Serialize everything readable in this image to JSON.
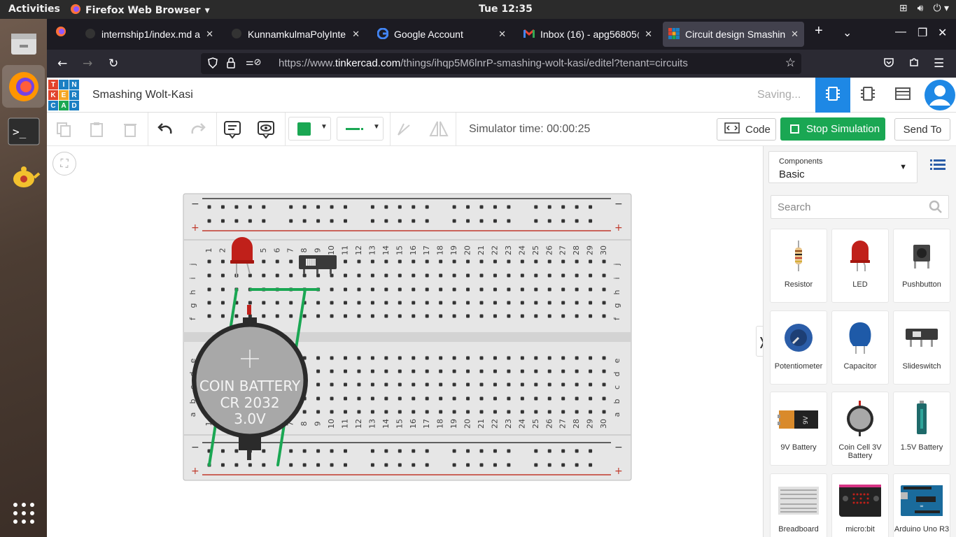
{
  "system_bar": {
    "activities": "Activities",
    "app_name": "Firefox Web Browser",
    "clock": "Tue 12:35"
  },
  "tabs": [
    {
      "title": "internship1/index.md a"
    },
    {
      "title": "KunnamkulmaPolyInte"
    },
    {
      "title": "Google Account"
    },
    {
      "title": "Inbox (16) - apg56805@"
    },
    {
      "title": "Circuit design Smashin"
    }
  ],
  "url": {
    "prefix": "https://www.",
    "domain": "tinkercad.com",
    "path": "/things/ihqp5M6lnrP-smashing-wolt-kasi/editel?tenant=circuits"
  },
  "tinkercad": {
    "logo_letters": [
      "T",
      "I",
      "N",
      "K",
      "E",
      "R",
      "C",
      "A",
      "D"
    ],
    "logo_colors": [
      "#e2432c",
      "#1b7fc3",
      "#1b7fc3",
      "#e2432c",
      "#f5a623",
      "#1b7fc3",
      "#1b7fc3",
      "#1aa753",
      "#1b7fc3"
    ],
    "project_title": "Smashing Wolt-Kasi",
    "saving": "Saving..."
  },
  "toolbar": {
    "sim_time": "Simulator time: 00:00:25",
    "code": "Code",
    "stop": "Stop Simulation",
    "send_to": "Send To",
    "wire_color": "#1aa753"
  },
  "battery": {
    "line1": "COIN BATTERY",
    "line2": "CR 2032",
    "line3": "3.0V"
  },
  "panel": {
    "components_label": "Components",
    "components_value": "Basic",
    "search_placeholder": "Search",
    "items": [
      {
        "name": "Resistor"
      },
      {
        "name": "LED"
      },
      {
        "name": "Pushbutton"
      },
      {
        "name": "Potentiometer"
      },
      {
        "name": "Capacitor"
      },
      {
        "name": "Slideswitch"
      },
      {
        "name": "9V Battery"
      },
      {
        "name": "Coin Cell 3V Battery"
      },
      {
        "name": "1.5V Battery"
      },
      {
        "name": "Breadboard"
      },
      {
        "name": "micro:bit"
      },
      {
        "name": "Arduino Uno R3"
      }
    ]
  }
}
